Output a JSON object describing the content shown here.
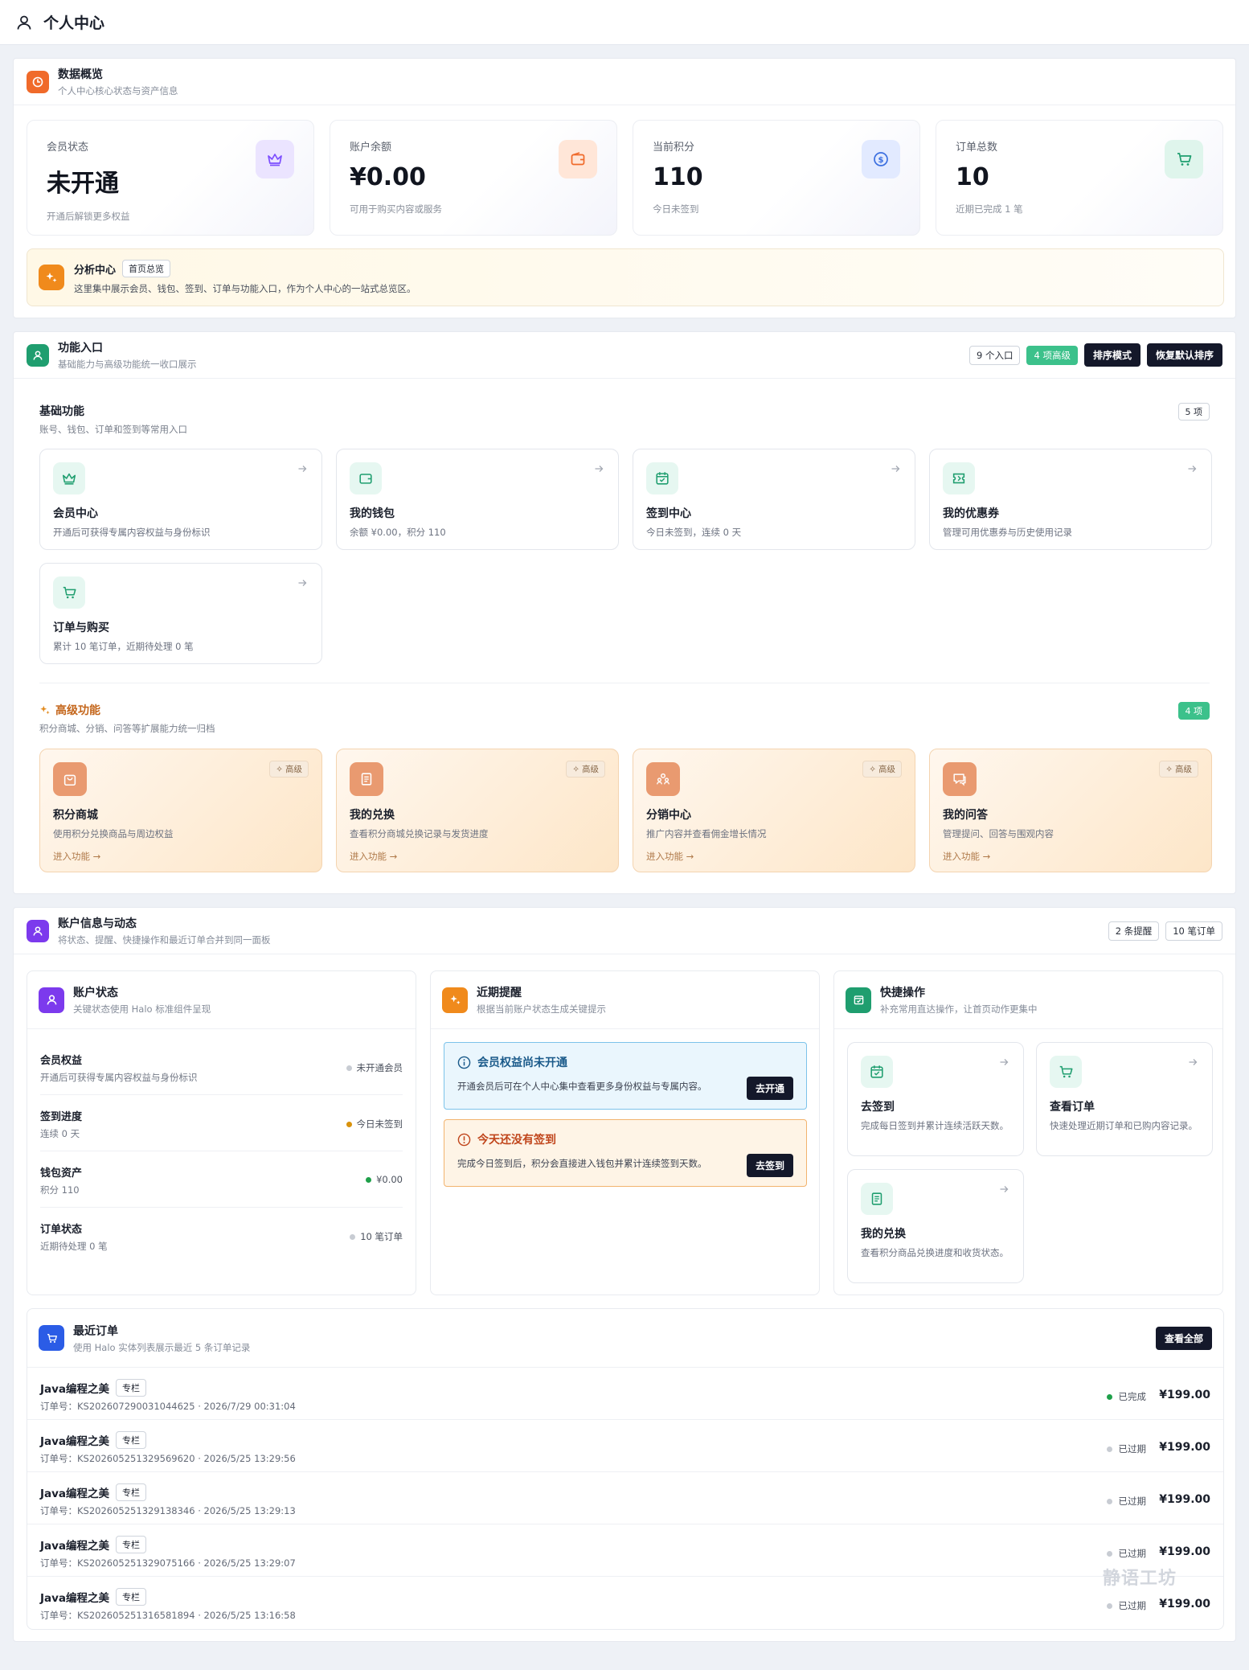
{
  "header": {
    "title": "个人中心"
  },
  "overview": {
    "title": "数据概览",
    "subtitle": "个人中心核心状态与资产信息",
    "stats": [
      {
        "label": "会员状态",
        "value": "未开通",
        "sub": "开通后解锁更多权益",
        "icon": "crown-icon",
        "color": "#7c4dff"
      },
      {
        "label": "账户余额",
        "value": "¥0.00",
        "sub": "可用于购买内容或服务",
        "icon": "wallet-icon",
        "color": "#f06a2a"
      },
      {
        "label": "当前积分",
        "value": "110",
        "sub": "今日未签到",
        "icon": "coin-icon",
        "color": "#3b6fe0"
      },
      {
        "label": "订单总数",
        "value": "10",
        "sub": "近期已完成 1 笔",
        "icon": "cart-icon",
        "color": "#1f9e6f"
      }
    ],
    "banner": {
      "title": "分析中心",
      "tag": "首页总览",
      "desc": "这里集中展示会员、钱包、签到、订单与功能入口，作为个人中心的一站式总览区。"
    }
  },
  "functions": {
    "title": "功能入口",
    "subtitle": "基础能力与高级功能统一收口展示",
    "count_tag": "9 个入口",
    "adv_tag": "4 项高级",
    "sort_button": "排序模式",
    "reset_button": "恢复默认排序",
    "basic": {
      "title": "基础功能",
      "subtitle": "账号、钱包、订单和签到等常用入口",
      "count": "5 项",
      "items": [
        {
          "name": "会员中心",
          "desc": "开通后可获得专属内容权益与身份标识"
        },
        {
          "name": "我的钱包",
          "desc": "余额 ¥0.00，积分 110"
        },
        {
          "name": "签到中心",
          "desc": "今日未签到，连续 0 天"
        },
        {
          "name": "我的优惠券",
          "desc": "管理可用优惠券与历史使用记录"
        },
        {
          "name": "订单与购买",
          "desc": "累计 10 笔订单，近期待处理 0 笔"
        }
      ]
    },
    "advanced": {
      "title": "高级功能",
      "subtitle": "积分商城、分销、问答等扩展能力统一归档",
      "count": "4 项",
      "badge": "高级",
      "go": "进入功能 →",
      "items": [
        {
          "name": "积分商城",
          "desc": "使用积分兑换商品与周边权益"
        },
        {
          "name": "我的兑换",
          "desc": "查看积分商城兑换记录与发货进度"
        },
        {
          "name": "分销中心",
          "desc": "推广内容并查看佣金增长情况"
        },
        {
          "name": "我的问答",
          "desc": "管理提问、回答与围观内容"
        }
      ]
    }
  },
  "account": {
    "title": "账户信息与动态",
    "subtitle": "将状态、提醒、快捷操作和最近订单合并到同一面板",
    "reminder_tag": "2 条提醒",
    "order_tag": "10 笔订单",
    "status": {
      "title": "账户状态",
      "subtitle": "关键状态使用 Halo 标准组件呈现",
      "rows": [
        {
          "title": "会员权益",
          "sub": "开通后可获得专属内容权益与身份标识",
          "value": "未开通会员",
          "dot": "#c8ccd3"
        },
        {
          "title": "签到进度",
          "sub": "连续 0 天",
          "value": "今日未签到",
          "dot": "#d9920c"
        },
        {
          "title": "钱包资产",
          "sub": "积分 110",
          "value": "¥0.00",
          "dot": "#1fa04a"
        },
        {
          "title": "订单状态",
          "sub": "近期待处理 0 笔",
          "value": "10 笔订单",
          "dot": "#c8ccd3"
        }
      ]
    },
    "reminders": {
      "title": "近期提醒",
      "subtitle": "根据当前账户状态生成关键提示",
      "items": [
        {
          "title": "会员权益尚未开通",
          "desc": "开通会员后可在个人中心集中查看更多身份权益与专属内容。",
          "button": "去开通"
        },
        {
          "title": "今天还没有签到",
          "desc": "完成今日签到后，积分会直接进入钱包并累计连续签到天数。",
          "button": "去签到"
        }
      ]
    },
    "quick": {
      "title": "快捷操作",
      "subtitle": "补充常用直达操作，让首页动作更集中",
      "items": [
        {
          "name": "去签到",
          "desc": "完成每日签到并累计连续活跃天数。"
        },
        {
          "name": "查看订单",
          "desc": "快速处理近期订单和已购内容记录。"
        },
        {
          "name": "我的兑换",
          "desc": "查看积分商品兑换进度和收货状态。"
        }
      ]
    },
    "orders": {
      "title": "最近订单",
      "subtitle": "使用 Halo 实体列表展示最近 5 条订单记录",
      "view_all": "查看全部",
      "items": [
        {
          "name": "Java编程之美",
          "tag": "专栏",
          "info": "订单号：KS20260729003104462​5 · 2026/7/29 00:31:04",
          "status": "已完成",
          "dot": "#1fa04a",
          "price": "¥199.00"
        },
        {
          "name": "Java编程之美",
          "tag": "专栏",
          "info": "订单号：KS202605251329569620 · 2026/5/25 13:29:56",
          "status": "已过期",
          "dot": "#c8ccd3",
          "price": "¥199.00"
        },
        {
          "name": "Java编程之美",
          "tag": "专栏",
          "info": "订单号：KS202605251329138346 · 2026/5/25 13:29:13",
          "status": "已过期",
          "dot": "#c8ccd3",
          "price": "¥199.00"
        },
        {
          "name": "Java编程之美",
          "tag": "专栏",
          "info": "订单号：KS202605251329075166 · 2026/5/25 13:29:07",
          "status": "已过期",
          "dot": "#c8ccd3",
          "price": "¥199.00"
        },
        {
          "name": "Java编程之美",
          "tag": "专栏",
          "info": "订单号：KS202605251316581894 · 2026/5/25 13:16:58",
          "status": "已过期",
          "dot": "#c8ccd3",
          "price": "¥199.00"
        }
      ]
    }
  },
  "watermark": "静语工坊"
}
